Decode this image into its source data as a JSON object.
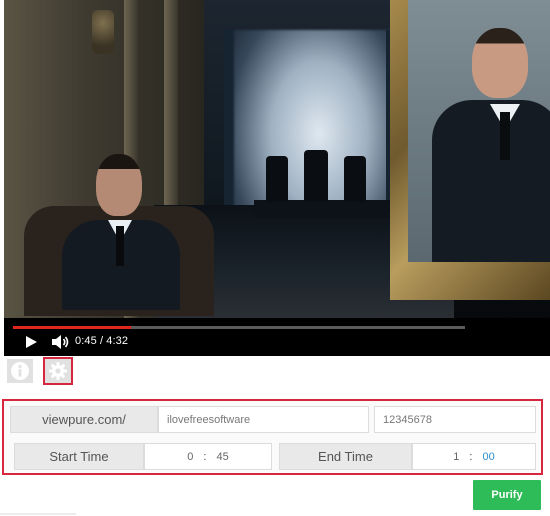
{
  "player": {
    "current_time": "0:45",
    "total_time": "4:32",
    "time_display": "0:45 / 4:32",
    "progress_fraction": 0.26,
    "colors": {
      "progress": "#e0261d",
      "track": "#5b5b5b"
    }
  },
  "toolbar": {
    "info_icon": "info-icon",
    "settings_icon": "gear-icon"
  },
  "form": {
    "url_label": "viewpure.com/",
    "path_value": "ilovefreesoftware",
    "password_value": "12345678",
    "start_label": "Start Time",
    "start_minutes": "0",
    "start_seconds": "45",
    "end_label": "End Time",
    "end_minutes": "1",
    "end_seconds": "00",
    "colon": ":"
  },
  "actions": {
    "purify_label": "Purify",
    "purify_color": "#2ebc58"
  },
  "highlight_color": "#d7263d"
}
